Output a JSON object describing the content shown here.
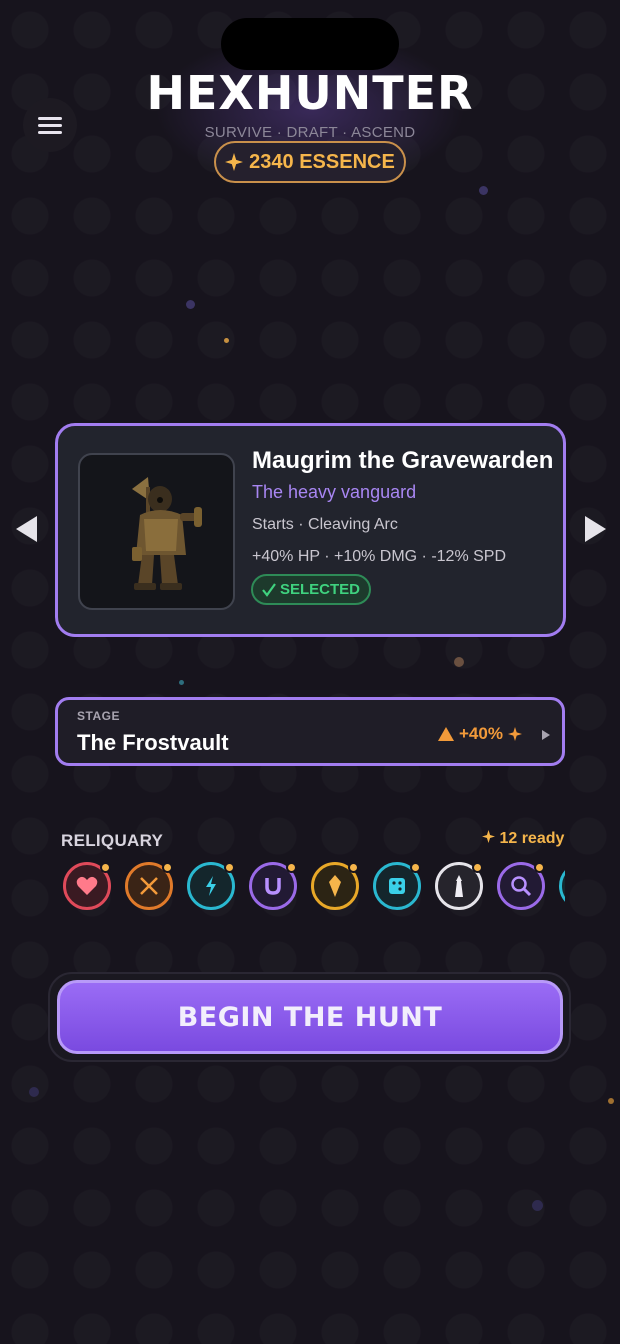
{
  "header": {
    "title": "HEXHUNTER",
    "tagline": "SURVIVE · DRAFT · ASCEND",
    "essence_icon": "sparkle-icon",
    "essence_label": "2340 ESSENCE"
  },
  "hero": {
    "name": "Maugrim the Gravewarden",
    "subtitle": "The heavy vanguard",
    "starts": "Starts · Cleaving Arc",
    "stats": "+40% HP · +10% DMG · -12% SPD",
    "badge": "SELECTED",
    "badge_icon": "check-icon"
  },
  "stage": {
    "label": "STAGE",
    "name": "The Frostvault",
    "modifier": "+40%"
  },
  "reliquary": {
    "title": "RELIQUARY",
    "ready": "12 ready",
    "items": [
      {
        "icon": "heart-icon",
        "color": "#e04a5a"
      },
      {
        "icon": "crossed-swords-icon",
        "color": "#e07a2a"
      },
      {
        "icon": "lightning-icon",
        "color": "#2ab8d0"
      },
      {
        "icon": "magnet-icon",
        "color": "#9a6ae8"
      },
      {
        "icon": "crystal-icon",
        "color": "#e8a828"
      },
      {
        "icon": "dice-icon",
        "color": "#2ab8d0"
      },
      {
        "icon": "tower-icon",
        "color": "#e6e4ea"
      },
      {
        "icon": "skull-search-icon",
        "color": "#9a6ae8"
      },
      {
        "icon": "partial-relic-icon",
        "color": "#2ab8d0"
      }
    ]
  },
  "actions": {
    "begin_label": "BEGIN THE HUNT"
  },
  "colors": {
    "accent": "#a27df0",
    "gold": "#f5b54b",
    "success": "#3fd27f",
    "background": "#17141d"
  }
}
